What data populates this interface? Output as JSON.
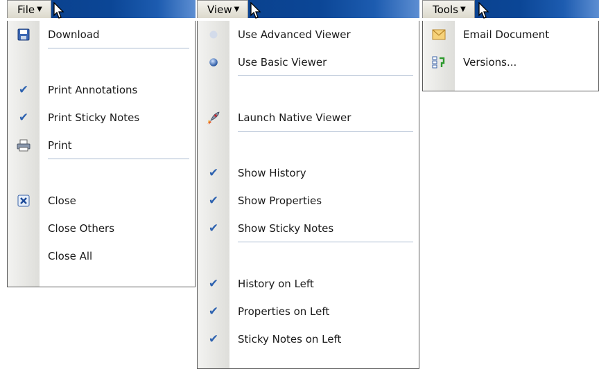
{
  "menus": {
    "file": {
      "title": "File",
      "items": {
        "download": "Download",
        "print_annotations": "Print Annotations",
        "print_sticky_notes": "Print Sticky Notes",
        "print": "Print",
        "close": "Close",
        "close_others": "Close Others",
        "close_all": "Close All"
      }
    },
    "view": {
      "title": "View",
      "items": {
        "use_advanced_viewer": "Use Advanced Viewer",
        "use_basic_viewer": "Use Basic Viewer",
        "launch_native_viewer": "Launch Native Viewer",
        "show_history": "Show History",
        "show_properties": "Show Properties",
        "show_sticky_notes": "Show Sticky Notes",
        "history_on_left": "History on Left",
        "properties_on_left": "Properties on Left",
        "sticky_notes_on_left": "Sticky Notes on Left"
      }
    },
    "tools": {
      "title": "Tools",
      "items": {
        "email_document": "Email Document",
        "versions": "Versions..."
      }
    }
  },
  "colors": {
    "menubar": "#0b4696",
    "check": "#2f63b0",
    "separator": "#a9b9cf"
  }
}
